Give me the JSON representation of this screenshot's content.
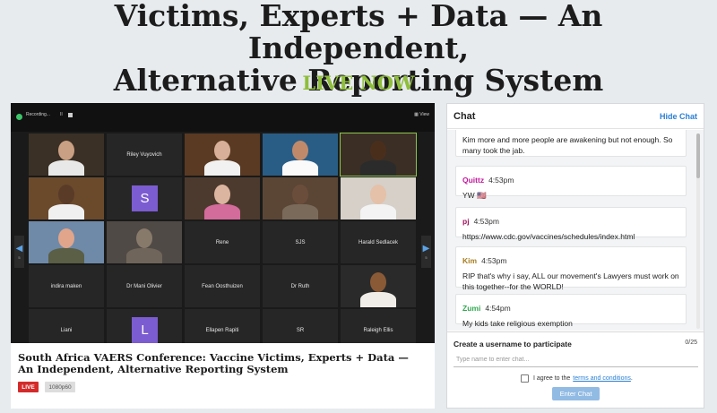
{
  "header": {
    "title_line1": "Victims, Experts + Data — An Independent,",
    "title_line2": "Alternative Reporting System",
    "live_now": "LIVE NOW"
  },
  "video": {
    "recording_label": "Recording...",
    "pause_label": "II",
    "view_label": "View",
    "tiles": [
      {
        "name": "",
        "photo": true
      },
      {
        "name": "Riley Vuyovich",
        "photo": false
      },
      {
        "name": "",
        "photo": true
      },
      {
        "name": "",
        "photo": true
      },
      {
        "name": "",
        "photo": true,
        "active": true
      },
      {
        "name": "",
        "photo": true
      },
      {
        "name": "",
        "avatar": "S"
      },
      {
        "name": "",
        "photo": true
      },
      {
        "name": "",
        "photo": true
      },
      {
        "name": "",
        "photo": true
      },
      {
        "name": "",
        "photo": true
      },
      {
        "name": "",
        "photo": true
      },
      {
        "name": "Rene",
        "photo": false
      },
      {
        "name": "SJS",
        "photo": false
      },
      {
        "name": "Harald Sedlacek",
        "photo": false
      },
      {
        "name": "indira maken",
        "photo": false
      },
      {
        "name": "Dr Mani Olivier",
        "photo": false
      },
      {
        "name": "Fean Oosthuizen",
        "photo": false
      },
      {
        "name": "Dr Ruth",
        "photo": false
      },
      {
        "name": "",
        "photo": true
      },
      {
        "name": "Liani",
        "photo": false
      },
      {
        "name": "",
        "avatar": "L"
      },
      {
        "name": "Ellapen Rapiti",
        "photo": false
      },
      {
        "name": "SR",
        "photo": false
      },
      {
        "name": "Raleigh Ellis",
        "photo": false
      }
    ],
    "page_left": "5",
    "page_right": "5"
  },
  "info": {
    "title": "South Africa VAERS Conference: Vaccine Victims, Experts + Data — An Independent, Alternative Reporting System",
    "live_badge": "LIVE",
    "resolution": "1080p60"
  },
  "chat": {
    "title": "Chat",
    "hide_label": "Hide Chat",
    "messages": [
      {
        "user": "",
        "time": "",
        "text": "Kim more and more people are awakening but not enough. So many took the jab.",
        "color": "#222222"
      },
      {
        "user": "Quittz",
        "time": "4:53pm",
        "text": "YW 🇺🇸",
        "color": "#c2189b"
      },
      {
        "user": "pj",
        "time": "4:53pm",
        "text": "https://www.cdc.gov/vaccines/schedules/index.html",
        "color": "#a0155e"
      },
      {
        "user": "Kim",
        "time": "4:53pm",
        "text": "RIP that's why i say, ALL our movement's Lawyers must work on this together--for the WORLD!",
        "color": "#a67c1f"
      },
      {
        "user": "Zumi",
        "time": "4:54pm",
        "text": "My kids take religious exemption",
        "color": "#2fa84f"
      }
    ],
    "compose_label": "Create a username to participate",
    "char_count": "0/25",
    "input_placeholder": "Type name to enter chat...",
    "agree_text": "I agree to the",
    "terms_link": "terms and conditions",
    "agree_suffix": ".",
    "enter_button": "Enter Chat"
  }
}
